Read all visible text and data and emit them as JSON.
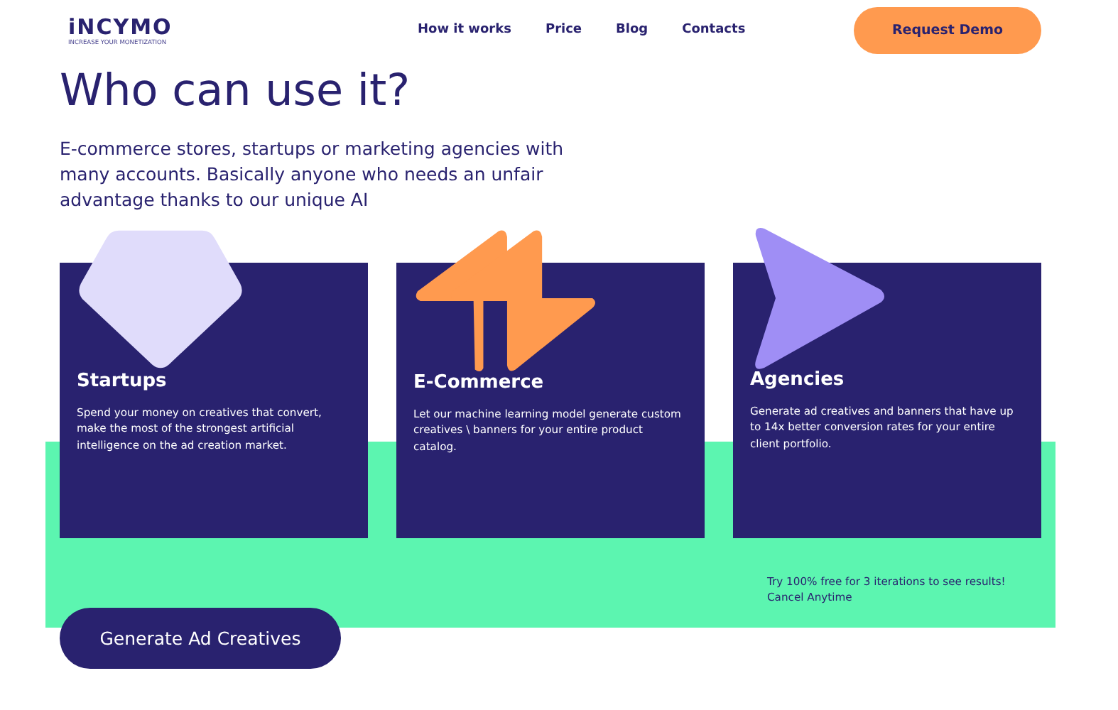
{
  "header": {
    "logo": "iNCYMO",
    "tagline": "INCREASE YOUR MONETIZATION",
    "nav": [
      "How it works",
      "Price",
      "Blog",
      "Contacts"
    ],
    "cta": "Request Demo"
  },
  "title": "Who can use it?",
  "intro": "E-commerce stores, startups or marketing agencies with many accounts. Basically anyone who needs an unfair advantage thanks to our unique AI",
  "cards": [
    {
      "kind": "pentagon",
      "title": "Startups",
      "text": "Spend your money on creatives that convert, make the most of the strongest artificial intelligence on the ad creation market."
    },
    {
      "kind": "bolt",
      "title": "E-Commerce",
      "text": "Let our machine learning model generate custom creatives \\ banners for your entire product catalog."
    },
    {
      "kind": "arrow",
      "title": "Agencies",
      "text": "Generate ad creatives and banners that have up to 14x better conversion rates for your entire client portfolio."
    }
  ],
  "trial": [
    "Try 100% free for 3 iterations to see results!",
    "Cancel Anytime"
  ],
  "button": "Generate Ad Creatives"
}
